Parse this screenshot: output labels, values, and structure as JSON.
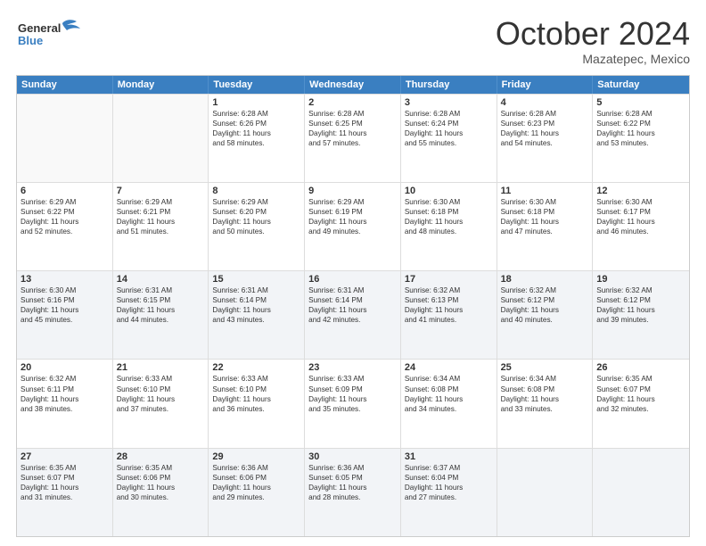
{
  "header": {
    "logo_line1": "General",
    "logo_line2": "Blue",
    "month": "October 2024",
    "location": "Mazatepec, Mexico"
  },
  "weekdays": [
    "Sunday",
    "Monday",
    "Tuesday",
    "Wednesday",
    "Thursday",
    "Friday",
    "Saturday"
  ],
  "rows": [
    [
      {
        "day": "",
        "lines": [],
        "empty": true
      },
      {
        "day": "",
        "lines": [],
        "empty": true
      },
      {
        "day": "1",
        "lines": [
          "Sunrise: 6:28 AM",
          "Sunset: 6:26 PM",
          "Daylight: 11 hours",
          "and 58 minutes."
        ]
      },
      {
        "day": "2",
        "lines": [
          "Sunrise: 6:28 AM",
          "Sunset: 6:25 PM",
          "Daylight: 11 hours",
          "and 57 minutes."
        ]
      },
      {
        "day": "3",
        "lines": [
          "Sunrise: 6:28 AM",
          "Sunset: 6:24 PM",
          "Daylight: 11 hours",
          "and 55 minutes."
        ]
      },
      {
        "day": "4",
        "lines": [
          "Sunrise: 6:28 AM",
          "Sunset: 6:23 PM",
          "Daylight: 11 hours",
          "and 54 minutes."
        ]
      },
      {
        "day": "5",
        "lines": [
          "Sunrise: 6:28 AM",
          "Sunset: 6:22 PM",
          "Daylight: 11 hours",
          "and 53 minutes."
        ]
      }
    ],
    [
      {
        "day": "6",
        "lines": [
          "Sunrise: 6:29 AM",
          "Sunset: 6:22 PM",
          "Daylight: 11 hours",
          "and 52 minutes."
        ]
      },
      {
        "day": "7",
        "lines": [
          "Sunrise: 6:29 AM",
          "Sunset: 6:21 PM",
          "Daylight: 11 hours",
          "and 51 minutes."
        ]
      },
      {
        "day": "8",
        "lines": [
          "Sunrise: 6:29 AM",
          "Sunset: 6:20 PM",
          "Daylight: 11 hours",
          "and 50 minutes."
        ]
      },
      {
        "day": "9",
        "lines": [
          "Sunrise: 6:29 AM",
          "Sunset: 6:19 PM",
          "Daylight: 11 hours",
          "and 49 minutes."
        ]
      },
      {
        "day": "10",
        "lines": [
          "Sunrise: 6:30 AM",
          "Sunset: 6:18 PM",
          "Daylight: 11 hours",
          "and 48 minutes."
        ]
      },
      {
        "day": "11",
        "lines": [
          "Sunrise: 6:30 AM",
          "Sunset: 6:18 PM",
          "Daylight: 11 hours",
          "and 47 minutes."
        ]
      },
      {
        "day": "12",
        "lines": [
          "Sunrise: 6:30 AM",
          "Sunset: 6:17 PM",
          "Daylight: 11 hours",
          "and 46 minutes."
        ]
      }
    ],
    [
      {
        "day": "13",
        "lines": [
          "Sunrise: 6:30 AM",
          "Sunset: 6:16 PM",
          "Daylight: 11 hours",
          "and 45 minutes."
        ],
        "shaded": true
      },
      {
        "day": "14",
        "lines": [
          "Sunrise: 6:31 AM",
          "Sunset: 6:15 PM",
          "Daylight: 11 hours",
          "and 44 minutes."
        ],
        "shaded": true
      },
      {
        "day": "15",
        "lines": [
          "Sunrise: 6:31 AM",
          "Sunset: 6:14 PM",
          "Daylight: 11 hours",
          "and 43 minutes."
        ],
        "shaded": true
      },
      {
        "day": "16",
        "lines": [
          "Sunrise: 6:31 AM",
          "Sunset: 6:14 PM",
          "Daylight: 11 hours",
          "and 42 minutes."
        ],
        "shaded": true
      },
      {
        "day": "17",
        "lines": [
          "Sunrise: 6:32 AM",
          "Sunset: 6:13 PM",
          "Daylight: 11 hours",
          "and 41 minutes."
        ],
        "shaded": true
      },
      {
        "day": "18",
        "lines": [
          "Sunrise: 6:32 AM",
          "Sunset: 6:12 PM",
          "Daylight: 11 hours",
          "and 40 minutes."
        ],
        "shaded": true
      },
      {
        "day": "19",
        "lines": [
          "Sunrise: 6:32 AM",
          "Sunset: 6:12 PM",
          "Daylight: 11 hours",
          "and 39 minutes."
        ],
        "shaded": true
      }
    ],
    [
      {
        "day": "20",
        "lines": [
          "Sunrise: 6:32 AM",
          "Sunset: 6:11 PM",
          "Daylight: 11 hours",
          "and 38 minutes."
        ]
      },
      {
        "day": "21",
        "lines": [
          "Sunrise: 6:33 AM",
          "Sunset: 6:10 PM",
          "Daylight: 11 hours",
          "and 37 minutes."
        ]
      },
      {
        "day": "22",
        "lines": [
          "Sunrise: 6:33 AM",
          "Sunset: 6:10 PM",
          "Daylight: 11 hours",
          "and 36 minutes."
        ]
      },
      {
        "day": "23",
        "lines": [
          "Sunrise: 6:33 AM",
          "Sunset: 6:09 PM",
          "Daylight: 11 hours",
          "and 35 minutes."
        ]
      },
      {
        "day": "24",
        "lines": [
          "Sunrise: 6:34 AM",
          "Sunset: 6:08 PM",
          "Daylight: 11 hours",
          "and 34 minutes."
        ]
      },
      {
        "day": "25",
        "lines": [
          "Sunrise: 6:34 AM",
          "Sunset: 6:08 PM",
          "Daylight: 11 hours",
          "and 33 minutes."
        ]
      },
      {
        "day": "26",
        "lines": [
          "Sunrise: 6:35 AM",
          "Sunset: 6:07 PM",
          "Daylight: 11 hours",
          "and 32 minutes."
        ]
      }
    ],
    [
      {
        "day": "27",
        "lines": [
          "Sunrise: 6:35 AM",
          "Sunset: 6:07 PM",
          "Daylight: 11 hours",
          "and 31 minutes."
        ],
        "shaded": true
      },
      {
        "day": "28",
        "lines": [
          "Sunrise: 6:35 AM",
          "Sunset: 6:06 PM",
          "Daylight: 11 hours",
          "and 30 minutes."
        ],
        "shaded": true
      },
      {
        "day": "29",
        "lines": [
          "Sunrise: 6:36 AM",
          "Sunset: 6:06 PM",
          "Daylight: 11 hours",
          "and 29 minutes."
        ],
        "shaded": true
      },
      {
        "day": "30",
        "lines": [
          "Sunrise: 6:36 AM",
          "Sunset: 6:05 PM",
          "Daylight: 11 hours",
          "and 28 minutes."
        ],
        "shaded": true
      },
      {
        "day": "31",
        "lines": [
          "Sunrise: 6:37 AM",
          "Sunset: 6:04 PM",
          "Daylight: 11 hours",
          "and 27 minutes."
        ],
        "shaded": true
      },
      {
        "day": "",
        "lines": [],
        "empty": true,
        "shaded": true
      },
      {
        "day": "",
        "lines": [],
        "empty": true,
        "shaded": true
      }
    ]
  ]
}
